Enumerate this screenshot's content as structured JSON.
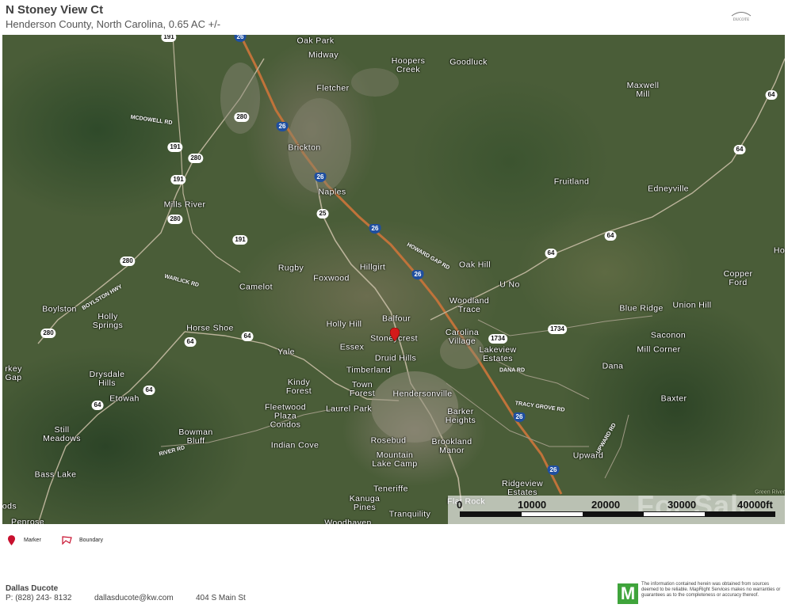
{
  "header": {
    "title": "N Stoney View Ct",
    "subtitle": "Henderson County, North Carolina, 0.65 AC +/-",
    "logo_text": "DUCOTE"
  },
  "map": {
    "places": [
      {
        "label": "Oak Park",
        "key": "oak-park"
      },
      {
        "label": "Midway",
        "key": "midway"
      },
      {
        "label": "Hoopers\nCreek",
        "key": "hoopers-creek"
      },
      {
        "label": "Goodluck",
        "key": "goodluck"
      },
      {
        "label": "Fletcher",
        "key": "fletcher"
      },
      {
        "label": "Maxwell\nMill",
        "key": "maxwell-mill"
      },
      {
        "label": "Brickton",
        "key": "brickton"
      },
      {
        "label": "Naples",
        "key": "naples"
      },
      {
        "label": "Fruitland",
        "key": "fruitland"
      },
      {
        "label": "Edneyville",
        "key": "edneyville"
      },
      {
        "label": "Mills River",
        "key": "mills-river"
      },
      {
        "label": "Rugby",
        "key": "rugby"
      },
      {
        "label": "Hillgirt",
        "key": "hillgirt"
      },
      {
        "label": "Oak Hill",
        "key": "oak-hill"
      },
      {
        "label": "Foxwood",
        "key": "foxwood"
      },
      {
        "label": "Camelot",
        "key": "camelot"
      },
      {
        "label": "Copper\nFord",
        "key": "copper-ford"
      },
      {
        "label": "U No",
        "key": "u-no"
      },
      {
        "label": "Ho",
        "key": "ho"
      },
      {
        "label": "Woodland\nTrace",
        "key": "woodland-trace"
      },
      {
        "label": "Blue Ridge",
        "key": "blue-ridge"
      },
      {
        "label": "Union Hill",
        "key": "union-hill"
      },
      {
        "label": "Boylston",
        "key": "boylston"
      },
      {
        "label": "Holly\nSprings",
        "key": "holly-springs"
      },
      {
        "label": "Balfour",
        "key": "balfour"
      },
      {
        "label": "Holly Hill",
        "key": "holly-hill"
      },
      {
        "label": "Horse Shoe",
        "key": "horse-shoe"
      },
      {
        "label": "Stoneycrest",
        "key": "stoneycrest"
      },
      {
        "label": "Carolina\nVillage",
        "key": "carolina-village"
      },
      {
        "label": "Saconon",
        "key": "saconon"
      },
      {
        "label": "Essex",
        "key": "essex"
      },
      {
        "label": "Lakeview\nEstates",
        "key": "lakeview-estates"
      },
      {
        "label": "Mill Corner",
        "key": "mill-corner"
      },
      {
        "label": "Yale",
        "key": "yale"
      },
      {
        "label": "Druid Hills",
        "key": "druid-hills"
      },
      {
        "label": "rkey\nGap",
        "key": "turkey-gap"
      },
      {
        "label": "Dana",
        "key": "dana"
      },
      {
        "label": "Timberland",
        "key": "timberland"
      },
      {
        "label": "Drysdale\nHills",
        "key": "drysdale-hills"
      },
      {
        "label": "Kindy\nForest",
        "key": "kindy-forest"
      },
      {
        "label": "Town\nForest",
        "key": "town-forest"
      },
      {
        "label": "Hendersonville",
        "key": "hendersonville"
      },
      {
        "label": "Etowah",
        "key": "etowah"
      },
      {
        "label": "Baxter",
        "key": "baxter"
      },
      {
        "label": "Laurel Park",
        "key": "laurel-park"
      },
      {
        "label": "Fleetwood\nPlaza\nCondos",
        "key": "fleetwood-plaza-condos"
      },
      {
        "label": "Barker\nHeights",
        "key": "barker-heights"
      },
      {
        "label": "Still\nMeadows",
        "key": "still-meadows"
      },
      {
        "label": "Bowman\nBluff",
        "key": "bowman-bluff"
      },
      {
        "label": "Rosebud",
        "key": "rosebud"
      },
      {
        "label": "Indian Cove",
        "key": "indian-cove"
      },
      {
        "label": "Brookland\nManor",
        "key": "brookland-manor"
      },
      {
        "label": "Upward",
        "key": "upward"
      },
      {
        "label": "Mountain\nLake Camp",
        "key": "mountain-lake-camp"
      },
      {
        "label": "Bass Lake",
        "key": "bass-lake"
      },
      {
        "label": "Ridgeview\nEstates",
        "key": "ridgeview-estates"
      },
      {
        "label": "Teneriffe",
        "key": "teneriffe"
      },
      {
        "label": "Flat Rock",
        "key": "flat-rock"
      },
      {
        "label": "Kanuga\nPines",
        "key": "kanuga-pines"
      },
      {
        "label": "ods",
        "key": "woods"
      },
      {
        "label": "Tranquility",
        "key": "tranquility"
      },
      {
        "label": "Penrose",
        "key": "penrose"
      },
      {
        "label": "Woodhaven",
        "key": "woodhaven"
      }
    ],
    "road_labels": [
      {
        "label": "MCDOWELL RD",
        "key": "mcdowell-rd"
      },
      {
        "label": "HOWARD GAP RD",
        "key": "howard-gap-rd"
      },
      {
        "label": "BOYLSTON HWY",
        "key": "boylston-hwy"
      },
      {
        "label": "WARLICK RD",
        "key": "warlick-rd"
      },
      {
        "label": "DANA RD",
        "key": "dana-rd"
      },
      {
        "label": "TRACY GROVE RD",
        "key": "tracy-grove-rd"
      },
      {
        "label": "UPWARD RD",
        "key": "upward-rd"
      },
      {
        "label": "RIVER RD",
        "key": "river-rd"
      },
      {
        "label": "Green River",
        "key": "green-river"
      }
    ],
    "shields": [
      {
        "label": "191",
        "key": "us191-a",
        "type": "state"
      },
      {
        "label": "26",
        "key": "i26-a",
        "type": "interstate"
      },
      {
        "label": "280",
        "key": "nc280-a",
        "type": "state"
      },
      {
        "label": "26",
        "key": "i26-b",
        "type": "interstate"
      },
      {
        "label": "191",
        "key": "nc191-b",
        "type": "state"
      },
      {
        "label": "280",
        "key": "nc280-b",
        "type": "state"
      },
      {
        "label": "191",
        "key": "nc191-c",
        "type": "state"
      },
      {
        "label": "26",
        "key": "i26-c",
        "type": "interstate"
      },
      {
        "label": "64",
        "key": "us64-a",
        "type": "state"
      },
      {
        "label": "64",
        "key": "us64-b",
        "type": "state"
      },
      {
        "label": "25",
        "key": "us25",
        "type": "state"
      },
      {
        "label": "280",
        "key": "nc280-c",
        "type": "state"
      },
      {
        "label": "26",
        "key": "i26-d",
        "type": "interstate"
      },
      {
        "label": "191",
        "key": "nc191-d",
        "type": "state"
      },
      {
        "label": "64",
        "key": "us64-c",
        "type": "state"
      },
      {
        "label": "64",
        "key": "us64-d",
        "type": "state"
      },
      {
        "label": "280",
        "key": "nc280-d",
        "type": "state"
      },
      {
        "label": "26",
        "key": "i26-e",
        "type": "interstate"
      },
      {
        "label": "64",
        "key": "us64-e",
        "type": "state"
      },
      {
        "label": "64",
        "key": "us64-f",
        "type": "state"
      },
      {
        "label": "1734",
        "key": "sr1734-a",
        "type": "state"
      },
      {
        "label": "1734",
        "key": "sr1734-b",
        "type": "state"
      },
      {
        "label": "64",
        "key": "us64-g",
        "type": "state"
      },
      {
        "label": "64",
        "key": "us64-h",
        "type": "state"
      },
      {
        "label": "26",
        "key": "i26-f",
        "type": "interstate"
      },
      {
        "label": "26",
        "key": "i26-g",
        "type": "interstate"
      },
      {
        "label": "280",
        "key": "nc280-e",
        "type": "state"
      }
    ],
    "scale": {
      "ticks": [
        "0",
        "10000",
        "20000",
        "30000",
        "40000ft"
      ]
    },
    "watermark": "For Sale"
  },
  "legend": {
    "marker_label": "Marker",
    "boundary_label": "Boundary",
    "marker_color": "#c8102e",
    "boundary_color": "#c8102e"
  },
  "footer": {
    "agent_name": "Dallas Ducote",
    "phone": "P: (828) 243- 8132",
    "email": "dallasducote@kw.com",
    "address": "404 S Main St",
    "mapright_logo": "M",
    "disclaimer": "The information contained herein was obtained from sources deemed to be reliable. MapRight Services makes no warranties or guarantees as to the completeness or accuracy thereof."
  }
}
